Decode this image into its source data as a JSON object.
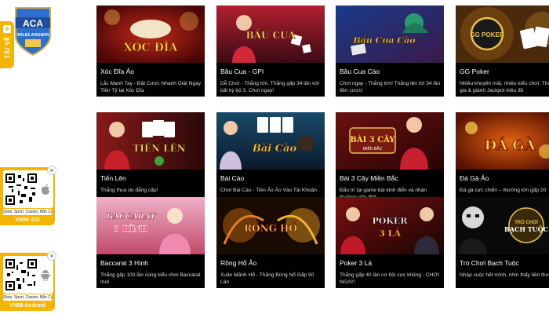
{
  "brand": {
    "logo_main": "ACA",
    "logo_sub": "ARLES AVIGNON"
  },
  "download": {
    "label": "TẢI VỀ"
  },
  "apps": [
    {
      "caption": "Slots, Sport, Casino, Bắn Cá",
      "title": "VN88 iOS",
      "os_icon": "apple-icon"
    },
    {
      "caption": "Slots, Sport, Casino, Bắn Cá",
      "title": "VN88 Android",
      "os_icon": "android-icon"
    }
  ],
  "colors": {
    "accent": "#f5b400",
    "card_bg": "#000000",
    "page_bg": "#ffffff"
  },
  "games": [
    {
      "title": "Xóc Đĩa Ảo",
      "description": "Lắc Mạnh Tay - Đặt Cược Nhanh Giật Ngay Tiền Tỷ tại Xóc Đĩa",
      "logo": "XÓC ĐĨA"
    },
    {
      "title": "Bầu Cua - GPI",
      "description": "Dễ Chơi - Thắng lớn. Thắng gấp 34 lần với bất kỳ bộ 3. Chơi ngay!",
      "logo": "BẦU CUA"
    },
    {
      "title": "Bầu Cua Cào",
      "description": "Chơi ngay - Thắng lớn! Thắng lên tới 34 lần tiền cược!",
      "logo": "Bầu Cua Cào"
    },
    {
      "title": "GG Poker",
      "description": "Nhiều khuyến mãi, nhiều kiểu chơi. Tham gia & giành Jackpot triệu đô",
      "logo": "GG POKER"
    },
    {
      "title": "Tiến Lên",
      "description": "Thắng thua do đẳng cấp!",
      "logo": "TIẾN LÊN"
    },
    {
      "title": "Bài Cào",
      "description": "Chơi Bài Cào - Tiền Ảo Ào Vào Tài Khoản",
      "logo": "Bài Cào"
    },
    {
      "title": "Bài 3 Cây Miền Bắc",
      "description": "Đấu trí tại game bài kinh điển và nhận thưởng gấp đôi!",
      "logo": "BÀI 3 CÂY",
      "logo_sub": "MIỀN BẮC"
    },
    {
      "title": "Đá Gà Ảo",
      "description": "Đá gà cực chiến – thưởng lớn gấp 20",
      "logo": "ĐÁ GÀ"
    },
    {
      "title": "Baccarat 3 Hình",
      "description": "Thắng gấp 100 lần cùng kiểu chơi Baccarat mới",
      "logo": "BACCARAT",
      "logo_sub": "3 HÌNH"
    },
    {
      "title": "Rồng Hổ Ảo",
      "description": "Xuân Mãnh Hổ - Thắng Bùng Nổ Gấp 50 Lần",
      "logo": "RỒNG HỔ"
    },
    {
      "title": "Poker 3 Lá",
      "description": "Thắng gấp 40 lần cơ hội cực khủng - CHƠI NGAY!",
      "logo": "POKER",
      "logo_sub": "3 LÁ"
    },
    {
      "title": "Trò Chơi Bạch Tuộc",
      "description": "Nhập cuộc hết mình, nhìn thấy tiền thưởng",
      "logo": "TRÒ CHƠI",
      "logo_sub": "BẠCH TUỘC"
    }
  ]
}
